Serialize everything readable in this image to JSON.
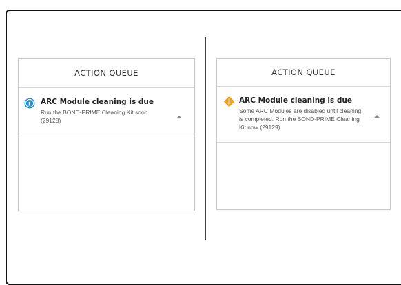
{
  "panels": [
    {
      "title": "ACTION QUEUE",
      "items": [
        {
          "severity": "info",
          "icon": "info-icon",
          "icon_color": "#1d8fd6",
          "title": "ARC Module cleaning is due",
          "description": "Run the BOND-PRIME Cleaning Kit soon (29128)"
        }
      ]
    },
    {
      "title": "ACTION QUEUE",
      "items": [
        {
          "severity": "warning",
          "icon": "warning-icon",
          "icon_color": "#f0a21f",
          "title": "ARC Module cleaning is due",
          "description": "Some ARC Modules are disabled until cleaning is completed. Run the BOND-PRIME Cleaning Kit now (29129)"
        }
      ]
    }
  ]
}
